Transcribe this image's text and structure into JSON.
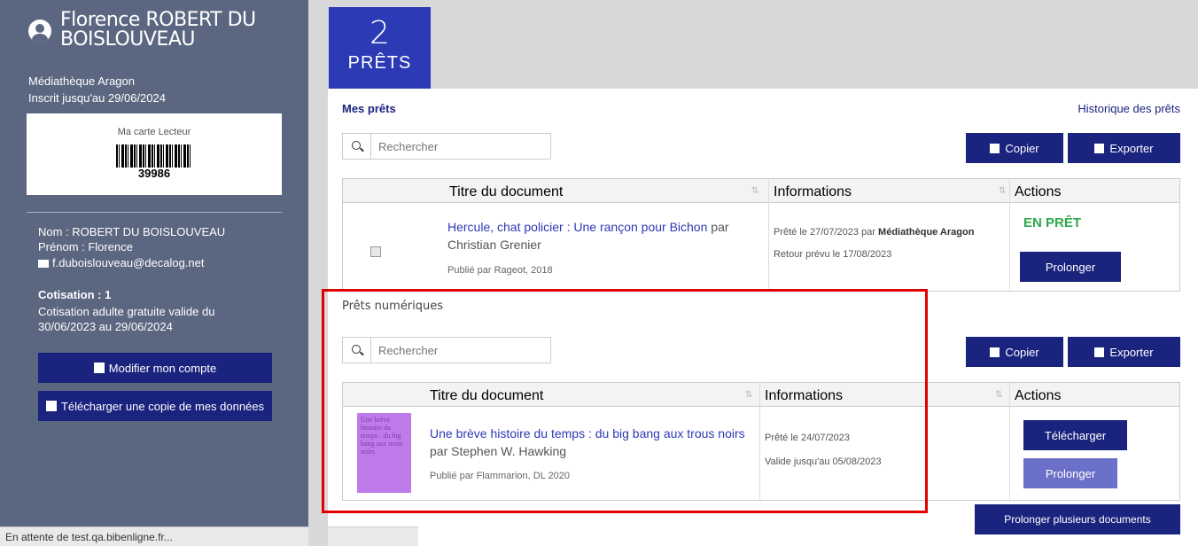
{
  "user": {
    "name": "Florence ROBERT DU BOISLOUVEAU",
    "library": "Médiathèque Aragon",
    "registered_until": "Inscrit jusqu'au 29/06/2024",
    "card_title": "Ma carte Lecteur",
    "card_number": "39986",
    "nom": "Nom : ROBERT DU BOISLOUVEAU",
    "prenom": "Prénom : Florence",
    "email": "f.duboislouveau@decalog.net",
    "cotisation_title": "Cotisation : 1",
    "cotisation_text": "Cotisation adulte gratuite valide du 30/06/2023 au 29/06/2024",
    "modify_label": "Modifier mon compte",
    "download_label": "Télécharger une copie de mes données"
  },
  "tile": {
    "count": "2",
    "label": "PRÊTS"
  },
  "loans": {
    "section_title": "Mes prêts",
    "history_link": "Historique des prêts",
    "search_placeholder": "Rechercher",
    "copy_label": "Copier",
    "export_label": "Exporter",
    "columns": [
      "Titre du document",
      "Informations",
      "Actions"
    ],
    "rows": [
      {
        "title": "Hercule, chat policier : Une rançon pour Bichon",
        "par": "par",
        "author": "Christian Grenier",
        "published": "Publié par Rageot, 2018",
        "loaned_prefix": "Prêté le 27/07/2023 par",
        "loaned_library": "Médiathèque Aragon",
        "return": "Retour prévu le 17/08/2023",
        "status": "EN PRÊT",
        "action": "Prolonger"
      }
    ]
  },
  "digital": {
    "section_title": "Prêts numériques",
    "search_placeholder": "Rechercher",
    "copy_label": "Copier",
    "export_label": "Exporter",
    "columns": [
      "Titre du document",
      "Informations",
      "Actions"
    ],
    "rows": [
      {
        "cover_text": "Une brève histoire du temps : du big bang aux trous noirs",
        "title": "Une brève histoire du temps : du big bang aux trous noirs",
        "author": "par Stephen W. Hawking",
        "published": "Publié par Flammarion, DL 2020",
        "loaned": "Prêté le 24/07/2023",
        "valid": "Valide jusqu'au 05/08/2023",
        "download": "Télécharger",
        "extend": "Prolonger"
      }
    ],
    "extend_many": "Prolonger plusieurs documents"
  },
  "statusbar": "En attente de test.qa.bibenligne.fr...",
  "colors": {
    "accent": "#1a237e",
    "tile": "#2d3ab5",
    "sidebar": "#5b6680",
    "status_green": "#2ea84a",
    "highlight": "#e00000",
    "extend_light": "#6b70c8"
  }
}
